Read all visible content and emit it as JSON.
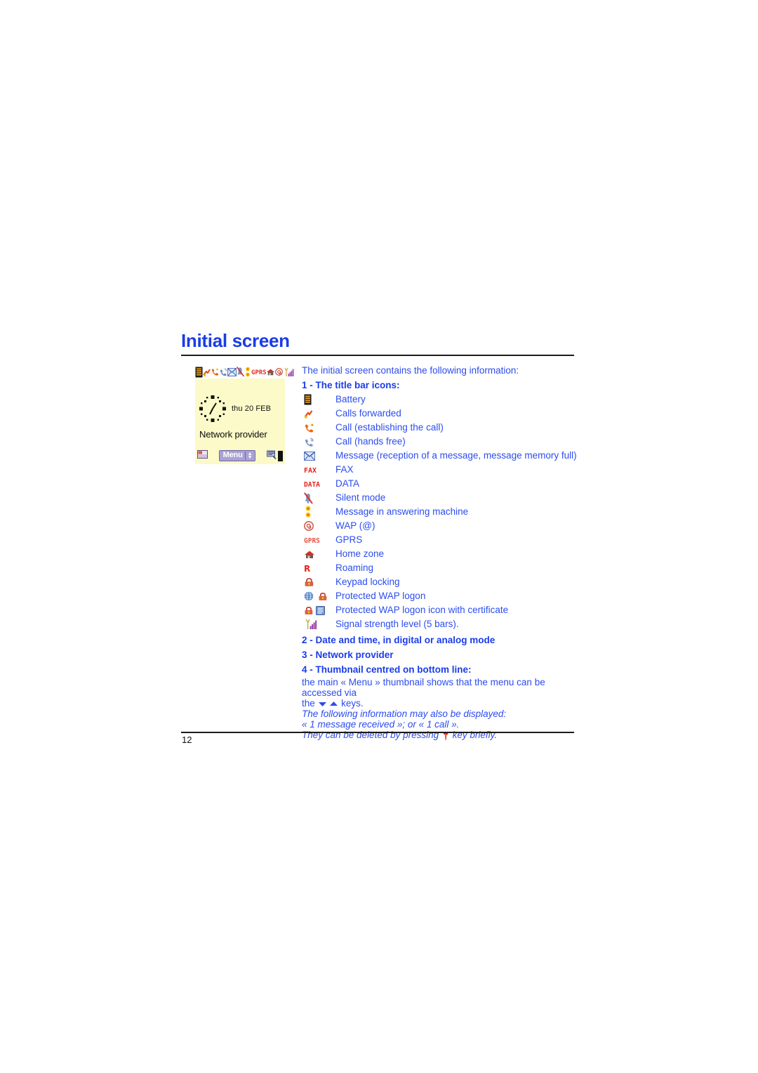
{
  "page": {
    "title": "Initial screen",
    "page_number": "12",
    "heading_color": "#1a3ce8",
    "body_color": "#2b4cf0",
    "screen_bg_color": "#fbfac8"
  },
  "phone_mock": {
    "date_text": "thu 20 FEB",
    "provider_text": "Network provider",
    "menu_label": "Menu",
    "titlebar_icons": [
      "battery-icon",
      "calls-forwarded-icon",
      "call-establishing-icon",
      "call-hands-free-icon",
      "message-icon",
      "silent-mode-icon",
      "answering-machine-icon",
      "gprs-icon",
      "home-zone-icon",
      "wap-icon",
      "signal-strength-icon"
    ],
    "bottombar_icons": [
      "thumbnail-left-icon",
      "thumbnail-right-icon",
      "cursor-block"
    ]
  },
  "content": {
    "intro": "The initial screen contains the following information:",
    "section1_heading": "1 - The title bar icons:",
    "icons": [
      {
        "icon": "battery-icon",
        "label": "Battery"
      },
      {
        "icon": "calls-forwarded-icon",
        "label": "Calls forwarded"
      },
      {
        "icon": "call-establishing-icon",
        "label": "Call (establishing the call)"
      },
      {
        "icon": "call-hands-free-icon",
        "label": "Call (hands free)"
      },
      {
        "icon": "message-icon",
        "label": "Message (reception of a message, message memory full)"
      },
      {
        "icon": "fax-icon",
        "label": "FAX"
      },
      {
        "icon": "data-icon",
        "label": "DATA"
      },
      {
        "icon": "silent-mode-icon",
        "label": "Silent mode"
      },
      {
        "icon": "answering-machine-icon",
        "label": "Message in answering machine"
      },
      {
        "icon": "wap-icon",
        "label": "WAP (@)"
      },
      {
        "icon": "gprs-icon",
        "label": "GPRS"
      },
      {
        "icon": "home-zone-icon",
        "label": "Home zone"
      },
      {
        "icon": "roaming-icon",
        "label": "Roaming"
      },
      {
        "icon": "keypad-lock-icon",
        "label": "Keypad locking"
      },
      {
        "icon": "protected-wap-logon-icon",
        "label": "Protected WAP logon"
      },
      {
        "icon": "protected-wap-certificate-icon",
        "label": "Protected WAP logon icon with certificate"
      },
      {
        "icon": "signal-strength-icon",
        "label": "Signal strength level (5 bars)."
      }
    ],
    "section2_heading": "2 - Date and time, in digital or analog mode",
    "section3_heading": "3 - Network provider",
    "section4_heading": "4 - Thumbnail centred on bottom line:",
    "para_line1": "the main « Menu » thumbnail shows that the menu can be accessed via",
    "para_line2_prefix": "the",
    "para_line2_suffix": "keys.",
    "italic_line1": "The following information may also be displayed:",
    "italic_line2": "« 1 message received »; or « 1 call ».",
    "italic_line3_prefix": "They can be deleted by pressing",
    "italic_line3_suffix": "key briefly."
  }
}
